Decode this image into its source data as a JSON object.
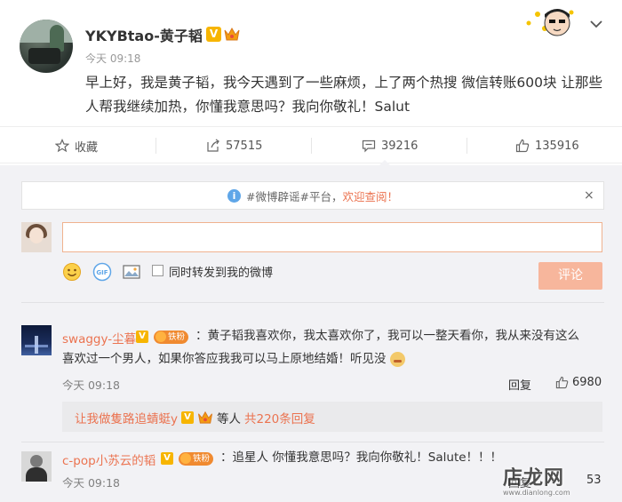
{
  "post": {
    "username": "YKYBtao-黄子韬",
    "verified_badge": "V",
    "time": "今天 09:18",
    "text": "早上好，我是黄子韬，我今天遇到了一些麻烦，上了两个热搜 微信转账600块 让那些人帮我继续加热，你懂我意思吗？我向你敬礼！Salut"
  },
  "actions": {
    "favorite": {
      "label": "收藏",
      "icon": "star-icon"
    },
    "repost": {
      "count": "57515",
      "icon": "share-icon"
    },
    "comment": {
      "count": "39216",
      "icon": "comment-icon"
    },
    "like": {
      "count": "135916",
      "icon": "thumbs-up-icon"
    }
  },
  "notice": {
    "prefix": "#微博辟谣#平台，",
    "highlight": "欢迎查阅！",
    "close": "×"
  },
  "composer": {
    "repost_label": "同时转发到我的微博",
    "submit_label": "评论",
    "gif_label": "GIF"
  },
  "comments": [
    {
      "name": "swaggy-尘暮",
      "badge": "V",
      "fan_label": "铁粉",
      "text_line1": "：黄子韬我喜欢你，我太喜欢你了，我可以一整天看你，我从来没有这么",
      "text_line2": "喜欢过一个男人，如果你答应我我可以马上原地结婚！听见没",
      "time": "今天 09:18",
      "reply": "回复",
      "likes": "6980"
    },
    {
      "name": "c-pop小苏云的韬",
      "badge": "V",
      "fan_label": "铁粉",
      "text": "：追星人 你懂我意思吗？我向你敬礼！Salute！！！",
      "time": "今天 09:18",
      "reply_partial": "回复",
      "likes_partial": "53"
    }
  ],
  "sub_replies": {
    "user": "让我做隻路追蜻蜓y",
    "badge": "V",
    "middle": "等人",
    "total": "共220条回复"
  },
  "watermark": {
    "text": "店龙网",
    "sub": "www.dianlong.com"
  },
  "colors": {
    "accent": "#eb7350",
    "gold": "#f7b500",
    "bg_comments": "#f2f2f5",
    "info_blue": "#5fa6e8"
  }
}
